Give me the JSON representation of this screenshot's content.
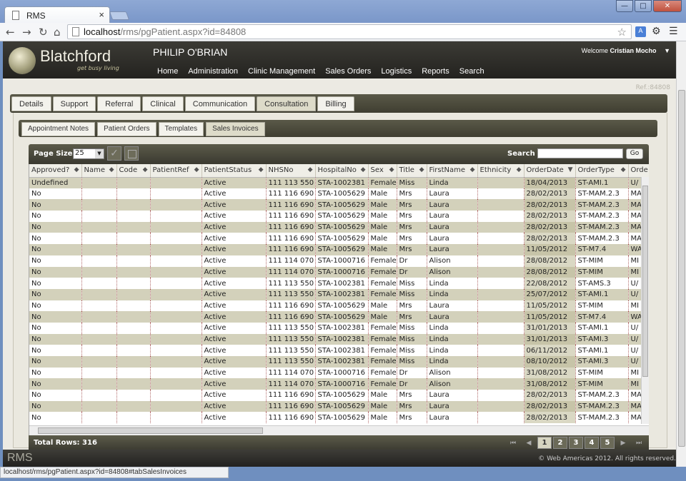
{
  "browser": {
    "tab_title": "RMS",
    "tab_close": "×",
    "url_host": "localhost",
    "url_path": "/rms/pgPatient.aspx?id=84808",
    "status_url": "localhost/rms/pgPatient.aspx?id=84808#tabSalesInvoices"
  },
  "header": {
    "brand": "Blatchford",
    "tagline": "get busy living",
    "patient_name": "PHILIP O'BRIAN",
    "welcome_prefix": "Welcome",
    "user_name": "Cristian Mocho",
    "user_menu_caret": "▼",
    "menu": [
      "Home",
      "Administration",
      "Clinic Management",
      "Sales Orders",
      "Logistics",
      "Reports",
      "Search"
    ]
  },
  "ref_text": "Ref.:84808",
  "tabs": [
    "Details",
    "Support",
    "Referral",
    "Clinical",
    "Communication",
    "Consultation",
    "Billing"
  ],
  "active_tab": "Consultation",
  "subtabs": [
    "Appointment Notes",
    "Patient Orders",
    "Templates",
    "Sales Invoices"
  ],
  "active_subtab": "Sales Invoices",
  "grid": {
    "page_size_label": "Page Size",
    "page_size_value": "25",
    "search_label": "Search",
    "search_value": "",
    "go_label": "Go",
    "columns": [
      {
        "label": "Approved?",
        "width": 73
      },
      {
        "label": "Name",
        "width": 49
      },
      {
        "label": "Code",
        "width": 47
      },
      {
        "label": "PatientRef",
        "width": 72
      },
      {
        "label": "PatientStatus",
        "width": 90
      },
      {
        "label": "NHSNo",
        "width": 69
      },
      {
        "label": "HospitalNo",
        "width": 74
      },
      {
        "label": "Sex",
        "width": 40
      },
      {
        "label": "Title",
        "width": 42
      },
      {
        "label": "FirstName",
        "width": 71
      },
      {
        "label": "Ethnicity",
        "width": 65
      },
      {
        "label": "OrderDate",
        "width": 72
      },
      {
        "label": "OrderType",
        "width": 74
      },
      {
        "label": "Orde",
        "width": 40
      }
    ],
    "sort_indicator": "▼",
    "rows": [
      [
        "Undefined",
        "",
        "",
        "",
        "Active",
        "111 113 550",
        "STA-1002381",
        "Female",
        "Miss",
        "Linda",
        "",
        "18/04/2013",
        "ST-AMI.1",
        "U/"
      ],
      [
        "No",
        "",
        "",
        "",
        "Active",
        "111 116 690",
        "STA-1005629",
        "Male",
        "Mrs",
        "Laura",
        "",
        "28/02/2013",
        "ST-MAM.2.3",
        "MA"
      ],
      [
        "No",
        "",
        "",
        "",
        "Active",
        "111 116 690",
        "STA-1005629",
        "Male",
        "Mrs",
        "Laura",
        "",
        "28/02/2013",
        "ST-MAM.2.3",
        "MA"
      ],
      [
        "No",
        "",
        "",
        "",
        "Active",
        "111 116 690",
        "STA-1005629",
        "Male",
        "Mrs",
        "Laura",
        "",
        "28/02/2013",
        "ST-MAM.2.3",
        "MA"
      ],
      [
        "No",
        "",
        "",
        "",
        "Active",
        "111 116 690",
        "STA-1005629",
        "Male",
        "Mrs",
        "Laura",
        "",
        "28/02/2013",
        "ST-MAM.2.3",
        "MA"
      ],
      [
        "No",
        "",
        "",
        "",
        "Active",
        "111 116 690",
        "STA-1005629",
        "Male",
        "Mrs",
        "Laura",
        "",
        "28/02/2013",
        "ST-MAM.2.3",
        "MA"
      ],
      [
        "No",
        "",
        "",
        "",
        "Active",
        "111 116 690",
        "STA-1005629",
        "Male",
        "Mrs",
        "Laura",
        "",
        "11/05/2012",
        "ST-M7.4",
        "WA"
      ],
      [
        "No",
        "",
        "",
        "",
        "Active",
        "111 114 070",
        "STA-1000716",
        "Female",
        "Dr",
        "Alison",
        "",
        "28/08/2012",
        "ST-MIM",
        "MI"
      ],
      [
        "No",
        "",
        "",
        "",
        "Active",
        "111 114 070",
        "STA-1000716",
        "Female",
        "Dr",
        "Alison",
        "",
        "28/08/2012",
        "ST-MIM",
        "MI"
      ],
      [
        "No",
        "",
        "",
        "",
        "Active",
        "111 113 550",
        "STA-1002381",
        "Female",
        "Miss",
        "Linda",
        "",
        "22/08/2012",
        "ST-AMS.3",
        "U/"
      ],
      [
        "No",
        "",
        "",
        "",
        "Active",
        "111 113 550",
        "STA-1002381",
        "Female",
        "Miss",
        "Linda",
        "",
        "25/07/2012",
        "ST-AMI.1",
        "U/"
      ],
      [
        "No",
        "",
        "",
        "",
        "Active",
        "111 116 690",
        "STA-1005629",
        "Male",
        "Mrs",
        "Laura",
        "",
        "11/05/2012",
        "ST-MIM",
        "MI"
      ],
      [
        "No",
        "",
        "",
        "",
        "Active",
        "111 116 690",
        "STA-1005629",
        "Male",
        "Mrs",
        "Laura",
        "",
        "11/05/2012",
        "ST-M7.4",
        "WA"
      ],
      [
        "No",
        "",
        "",
        "",
        "Active",
        "111 113 550",
        "STA-1002381",
        "Female",
        "Miss",
        "Linda",
        "",
        "31/01/2013",
        "ST-AMI.1",
        "U/"
      ],
      [
        "No",
        "",
        "",
        "",
        "Active",
        "111 113 550",
        "STA-1002381",
        "Female",
        "Miss",
        "Linda",
        "",
        "31/01/2013",
        "ST-AMI.3",
        "U/"
      ],
      [
        "No",
        "",
        "",
        "",
        "Active",
        "111 113 550",
        "STA-1002381",
        "Female",
        "Miss",
        "Linda",
        "",
        "06/11/2012",
        "ST-AMI.1",
        "U/"
      ],
      [
        "No",
        "",
        "",
        "",
        "Active",
        "111 113 550",
        "STA-1002381",
        "Female",
        "Miss",
        "Linda",
        "",
        "08/10/2012",
        "ST-AMI.3",
        "U/"
      ],
      [
        "No",
        "",
        "",
        "",
        "Active",
        "111 114 070",
        "STA-1000716",
        "Female",
        "Dr",
        "Alison",
        "",
        "31/08/2012",
        "ST-MIM",
        "MI"
      ],
      [
        "No",
        "",
        "",
        "",
        "Active",
        "111 114 070",
        "STA-1000716",
        "Female",
        "Dr",
        "Alison",
        "",
        "31/08/2012",
        "ST-MIM",
        "MI"
      ],
      [
        "No",
        "",
        "",
        "",
        "Active",
        "111 116 690",
        "STA-1005629",
        "Male",
        "Mrs",
        "Laura",
        "",
        "28/02/2013",
        "ST-MAM.2.3",
        "MA"
      ],
      [
        "No",
        "",
        "",
        "",
        "Active",
        "111 116 690",
        "STA-1005629",
        "Male",
        "Mrs",
        "Laura",
        "",
        "28/02/2013",
        "ST-MAM.2.3",
        "MA"
      ],
      [
        "No",
        "",
        "",
        "",
        "Active",
        "111 116 690",
        "STA-1005629",
        "Male",
        "Mrs",
        "Laura",
        "",
        "28/02/2013",
        "ST-MAM.2.3",
        "MA"
      ]
    ],
    "total_rows": "Total Rows: 316",
    "pages": [
      "1",
      "2",
      "3",
      "4",
      "5"
    ],
    "active_page": "1"
  },
  "footer": {
    "app": "RMS",
    "copyright": "© Web Americas 2012. All rights reserved."
  },
  "colors": {
    "header_bg": "#2b2a26",
    "row_even": "#d3d1bb",
    "row_odd": "#ffffff",
    "accent_olive": "#4a4938"
  },
  "icons": [
    "back-icon",
    "forward-icon",
    "reload-icon",
    "home-icon",
    "star-icon",
    "translate-icon",
    "extension-icon",
    "menu-icon",
    "check-icon",
    "excel-export-icon",
    "first-page-icon",
    "prev-page-icon",
    "next-page-icon",
    "last-page-icon"
  ]
}
